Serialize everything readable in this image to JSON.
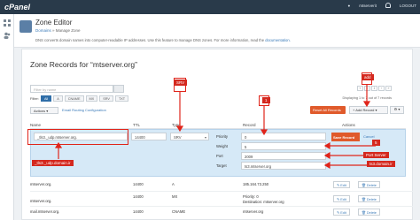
{
  "topbar": {
    "logo": "cPanel",
    "user": "mtserverit",
    "logout": "LOGOUT"
  },
  "header": {
    "title": "Zone Editor",
    "breadcrumb_home": "Domains",
    "breadcrumb_sep": " » ",
    "breadcrumb_current": "Manage Zone",
    "description": "DNS converts domain names into computer-readable IP addresses. Use this feature to manage DNS zones. For more information, read the",
    "doc_link": "documentation."
  },
  "panel": {
    "title": "Zone Records for “mtserver.org”",
    "search_placeholder": "Filter by name",
    "filter_label": "Filter:",
    "filters": [
      "All",
      "A",
      "CNAME",
      "MX",
      "SRV",
      "TXT"
    ],
    "actions_label": "Actions ▾",
    "auto_config": "Email Routing Configuration",
    "displaying": "Displaying 1 to 7 out of 7 records",
    "reset_label": "Reset All Records",
    "add_label": "+ Add Record",
    "add_caret": "▾",
    "gear": "⚙ ▾",
    "pager": [
      "«",
      "‹",
      "1",
      "›",
      "»"
    ]
  },
  "table": {
    "headers": {
      "name": "Name",
      "ttl": "TTL",
      "type": "Type",
      "record": "Record",
      "actions": "Actions"
    },
    "edit": {
      "name": "_tls3._udp.mtserver.org.",
      "ttl": "14400",
      "type": "SRV",
      "priority_label": "Priority",
      "priority": "0",
      "weight_label": "Weight",
      "weight": "5",
      "port_label": "Port",
      "port": "2009",
      "target_label": "Target",
      "target": "ts3.mtserver.org",
      "save": "Save Record",
      "cancel": "Cancel"
    },
    "rows": [
      {
        "name": "mtserver.org.",
        "ttl": "14400",
        "type": "A",
        "record": "185.164.73.250",
        "record2": ""
      },
      {
        "name": "mtserver.org.",
        "ttl": "14400",
        "type": "MX",
        "record": "Priority: 0",
        "record2": "Destination: mtserver.org"
      },
      {
        "name": "mail.mtserver.org.",
        "ttl": "14400",
        "type": "CNAME",
        "record": "mtserver.org",
        "record2": ""
      }
    ],
    "edit_btn": "✎ Edit",
    "delete_btn": "🗑 Delete"
  },
  "annotations": {
    "srv": "SRV",
    "add": "add",
    "num5": "5",
    "num1": "1",
    "port": "Port Server",
    "ts3": "ts3.domain.ir",
    "domain": "_tls3._udp.domain.ir"
  },
  "colors": {
    "topbar": "#293a4a",
    "accent": "#2f6ea8",
    "primary_action": "#e05a2b",
    "annotation": "#d4281e",
    "edit_row": "#d6e9f7"
  }
}
